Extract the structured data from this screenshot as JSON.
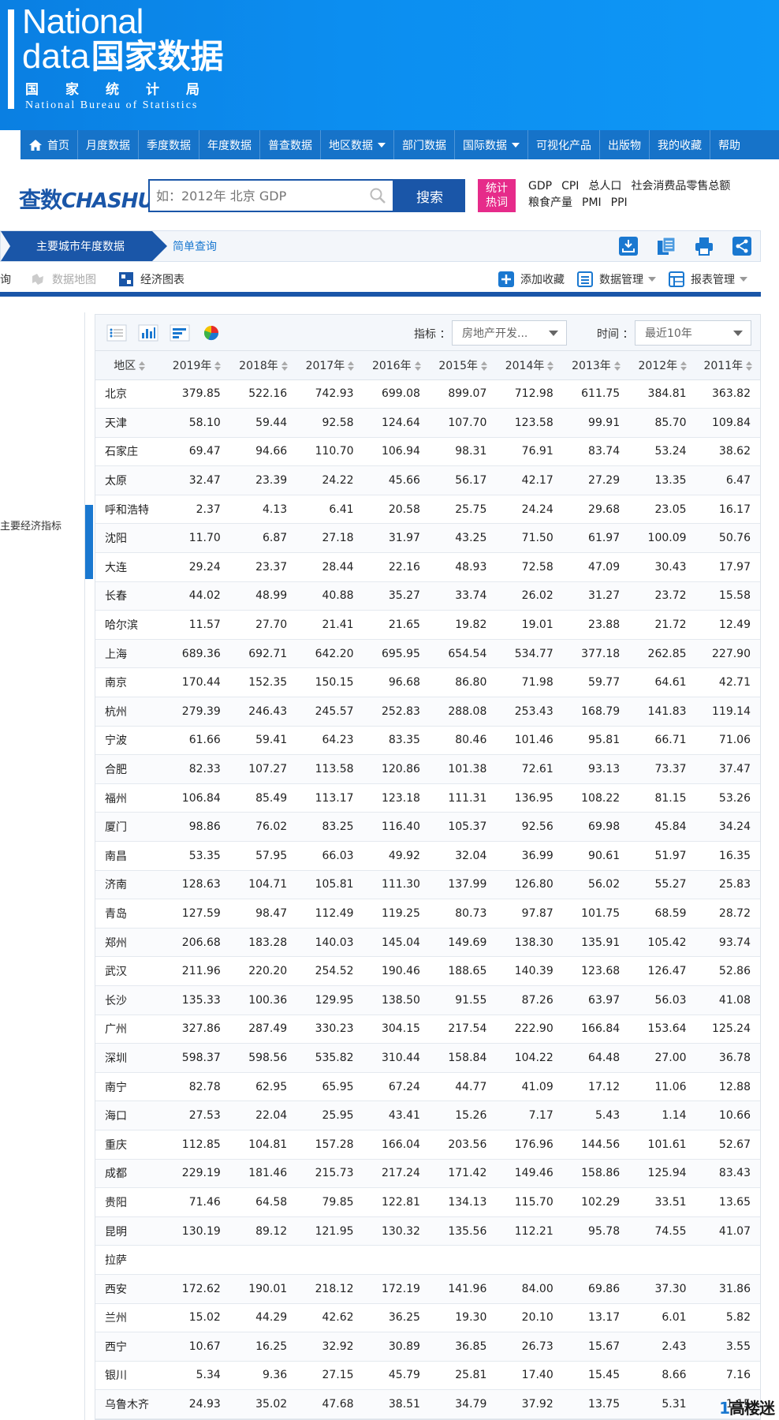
{
  "logo": {
    "line1": "National",
    "line2_en": "data",
    "line2_zh": "国家数据",
    "line3": "国家统计局",
    "line4": "National Bureau of Statistics"
  },
  "nav": [
    "首页",
    "月度数据",
    "季度数据",
    "年度数据",
    "普查数据",
    "地区数据",
    "部门数据",
    "国际数据",
    "可视化产品",
    "出版物",
    "我的收藏",
    "帮助"
  ],
  "search": {
    "brand_zh": "查数",
    "brand_en": "CHASHU",
    "placeholder": "如：2012年 北京 GDP",
    "button": "搜索",
    "hot_badge_1": "统计",
    "hot_badge_2": "热词",
    "hot_words": [
      "GDP",
      "CPI",
      "总人口",
      "社会消费品零售总额",
      "粮食产量",
      "PMI",
      "PPI"
    ]
  },
  "tabs": {
    "active": "主要城市年度数据",
    "second": "简单查询"
  },
  "toolbar2": {
    "query": "查询",
    "map": "数据地图",
    "chart": "经济图表",
    "favorite": "添加收藏",
    "data_manage": "数据管理",
    "report_manage": "报表管理"
  },
  "sidebar": {
    "label": "主要经济指标"
  },
  "filters": {
    "indicator_label": "指标 ：",
    "indicator_value": "房地产开发...",
    "time_label": "时间 ：",
    "time_value": "最近10年"
  },
  "table": {
    "headers": [
      "地区",
      "2019年",
      "2018年",
      "2017年",
      "2016年",
      "2015年",
      "2014年",
      "2013年",
      "2012年",
      "2011年"
    ],
    "rows": [
      [
        "北京",
        "379.85",
        "522.16",
        "742.93",
        "699.08",
        "899.07",
        "712.98",
        "611.75",
        "384.81",
        "363.82"
      ],
      [
        "天津",
        "58.10",
        "59.44",
        "92.58",
        "124.64",
        "107.70",
        "123.58",
        "99.91",
        "85.70",
        "109.84"
      ],
      [
        "石家庄",
        "69.47",
        "94.66",
        "110.70",
        "106.94",
        "98.31",
        "76.91",
        "83.74",
        "53.24",
        "38.62"
      ],
      [
        "太原",
        "32.47",
        "23.39",
        "24.22",
        "45.66",
        "56.17",
        "42.17",
        "27.29",
        "13.35",
        "6.47"
      ],
      [
        "呼和浩特",
        "2.37",
        "4.13",
        "6.41",
        "20.58",
        "25.75",
        "24.24",
        "29.68",
        "23.05",
        "16.17"
      ],
      [
        "沈阳",
        "11.70",
        "6.87",
        "27.18",
        "31.97",
        "43.25",
        "71.50",
        "61.97",
        "100.09",
        "50.76"
      ],
      [
        "大连",
        "29.24",
        "23.37",
        "28.44",
        "22.16",
        "48.93",
        "72.58",
        "47.09",
        "30.43",
        "17.97"
      ],
      [
        "长春",
        "44.02",
        "48.99",
        "40.88",
        "35.27",
        "33.74",
        "26.02",
        "31.27",
        "23.72",
        "15.58"
      ],
      [
        "哈尔滨",
        "11.57",
        "27.70",
        "21.41",
        "21.65",
        "19.82",
        "19.01",
        "23.88",
        "21.72",
        "12.49"
      ],
      [
        "上海",
        "689.36",
        "692.71",
        "642.20",
        "695.95",
        "654.54",
        "534.77",
        "377.18",
        "262.85",
        "227.90"
      ],
      [
        "南京",
        "170.44",
        "152.35",
        "150.15",
        "96.68",
        "86.80",
        "71.98",
        "59.77",
        "64.61",
        "42.71"
      ],
      [
        "杭州",
        "279.39",
        "246.43",
        "245.57",
        "252.83",
        "288.08",
        "253.43",
        "168.79",
        "141.83",
        "119.14"
      ],
      [
        "宁波",
        "61.66",
        "59.41",
        "64.23",
        "83.35",
        "80.46",
        "101.46",
        "95.81",
        "66.71",
        "71.06"
      ],
      [
        "合肥",
        "82.33",
        "107.27",
        "113.58",
        "120.86",
        "101.38",
        "72.61",
        "93.13",
        "73.37",
        "37.47"
      ],
      [
        "福州",
        "106.84",
        "85.49",
        "113.17",
        "123.18",
        "111.31",
        "136.95",
        "108.22",
        "81.15",
        "53.26"
      ],
      [
        "厦门",
        "98.86",
        "76.02",
        "83.25",
        "116.40",
        "105.37",
        "92.56",
        "69.98",
        "45.84",
        "34.24"
      ],
      [
        "南昌",
        "53.35",
        "57.95",
        "66.03",
        "49.92",
        "32.04",
        "36.99",
        "90.61",
        "51.97",
        "16.35"
      ],
      [
        "济南",
        "128.63",
        "104.71",
        "105.81",
        "111.30",
        "137.99",
        "126.80",
        "56.02",
        "55.27",
        "25.83"
      ],
      [
        "青岛",
        "127.59",
        "98.47",
        "112.49",
        "119.25",
        "80.73",
        "97.87",
        "101.75",
        "68.59",
        "28.72"
      ],
      [
        "郑州",
        "206.68",
        "183.28",
        "140.03",
        "145.04",
        "149.69",
        "138.30",
        "135.91",
        "105.42",
        "93.74"
      ],
      [
        "武汉",
        "211.96",
        "220.20",
        "254.52",
        "190.46",
        "188.65",
        "140.39",
        "123.68",
        "126.47",
        "52.86"
      ],
      [
        "长沙",
        "135.33",
        "100.36",
        "129.95",
        "138.50",
        "91.55",
        "87.26",
        "63.97",
        "56.03",
        "41.08"
      ],
      [
        "广州",
        "327.86",
        "287.49",
        "330.23",
        "304.15",
        "217.54",
        "222.90",
        "166.84",
        "153.64",
        "125.24"
      ],
      [
        "深圳",
        "598.37",
        "598.56",
        "535.82",
        "310.44",
        "158.84",
        "104.22",
        "64.48",
        "27.00",
        "36.78"
      ],
      [
        "南宁",
        "82.78",
        "62.95",
        "65.95",
        "67.24",
        "44.77",
        "41.09",
        "17.12",
        "11.06",
        "12.88"
      ],
      [
        "海口",
        "27.53",
        "22.04",
        "25.95",
        "43.41",
        "15.26",
        "7.17",
        "5.43",
        "1.14",
        "10.66"
      ],
      [
        "重庆",
        "112.85",
        "104.81",
        "157.28",
        "166.04",
        "203.56",
        "176.96",
        "144.56",
        "101.61",
        "52.67"
      ],
      [
        "成都",
        "229.19",
        "181.46",
        "215.73",
        "217.24",
        "171.42",
        "149.46",
        "158.86",
        "125.94",
        "83.43"
      ],
      [
        "贵阳",
        "71.46",
        "64.58",
        "79.85",
        "122.81",
        "134.13",
        "115.70",
        "102.29",
        "33.51",
        "13.65"
      ],
      [
        "昆明",
        "130.19",
        "89.12",
        "121.95",
        "130.32",
        "135.56",
        "112.21",
        "95.78",
        "74.55",
        "41.07"
      ],
      [
        "拉萨",
        "",
        "",
        "",
        "",
        "",
        "",
        "",
        "",
        ""
      ],
      [
        "西安",
        "172.62",
        "190.01",
        "218.12",
        "172.19",
        "141.96",
        "84.00",
        "69.86",
        "37.30",
        "31.86"
      ],
      [
        "兰州",
        "15.02",
        "44.29",
        "42.62",
        "36.25",
        "19.30",
        "20.10",
        "13.17",
        "6.01",
        "5.82"
      ],
      [
        "西宁",
        "10.67",
        "16.25",
        "32.92",
        "30.89",
        "36.85",
        "26.73",
        "15.67",
        "2.43",
        "3.55"
      ],
      [
        "银川",
        "5.34",
        "9.36",
        "27.15",
        "45.79",
        "25.81",
        "17.40",
        "15.45",
        "8.66",
        "7.16"
      ],
      [
        "乌鲁木齐",
        "24.93",
        "35.02",
        "47.68",
        "38.51",
        "34.79",
        "37.92",
        "13.75",
        "5.31",
        "1.15"
      ]
    ]
  },
  "watermark": {
    "one": "1",
    "text": "高楼迷"
  }
}
